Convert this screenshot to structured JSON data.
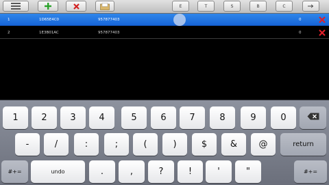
{
  "toolbar": {
    "left_buttons": [
      {
        "name": "menu",
        "icon": "list-icon"
      },
      {
        "name": "add",
        "icon": "plus-icon",
        "color": "#2aa22a"
      },
      {
        "name": "delete",
        "icon": "x-icon",
        "color": "#d22222"
      },
      {
        "name": "open",
        "icon": "folder-icon"
      }
    ],
    "column_buttons": [
      "E",
      "T",
      "S",
      "B",
      "C"
    ],
    "arrow_icon": "arrow-right-icon"
  },
  "table": {
    "rows": [
      {
        "index": "1",
        "code": "1D65E4C0",
        "number": "957877403",
        "val": "0",
        "selected": true
      },
      {
        "index": "2",
        "code": "1E3B01AC",
        "number": "957877403",
        "val": "0",
        "selected": false
      }
    ],
    "delete_color": "#e0202a",
    "selection_color": "#1e6fe0"
  },
  "keyboard": {
    "row1": [
      "1",
      "2",
      "3",
      "4",
      "5",
      "6",
      "7",
      "8",
      "9",
      "0"
    ],
    "backspace_icon": "backspace-icon",
    "row2": [
      "-",
      "/",
      ":",
      ";",
      "(",
      ")",
      "$",
      "&",
      "@"
    ],
    "return_label": "return",
    "row3": {
      "left": "#+=",
      "undo": "undo",
      "keys": [
        ".",
        ",",
        "?",
        "!",
        "'",
        "\""
      ],
      "right": "#+="
    }
  }
}
